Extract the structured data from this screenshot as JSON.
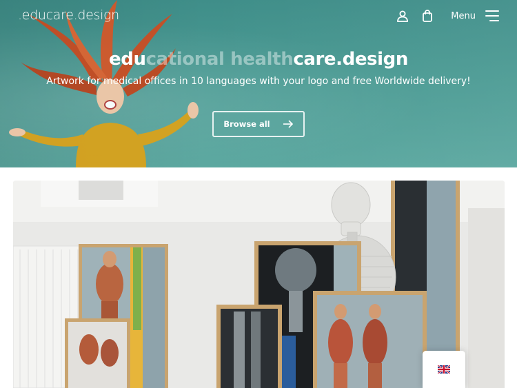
{
  "brand": {
    "logo": ".educare.design"
  },
  "header": {
    "account_icon": "user-icon",
    "cart_icon": "shopping-bag-icon",
    "menu_label": "Menu",
    "menu_icon": "hamburger-icon"
  },
  "hero": {
    "title_bold_1": "edu",
    "title_faded_1": "cational ",
    "title_faded_2": "health",
    "title_bold_2": "care.design",
    "subtitle": "Artwork for medical offices in 10 languages with your logo and free Worldwide delivery!",
    "browse_button": "Browse all",
    "browse_icon": "arrow-right-icon",
    "accent_color": "#4a9a93"
  },
  "language": {
    "flag_icon": "uk-flag-icon"
  }
}
